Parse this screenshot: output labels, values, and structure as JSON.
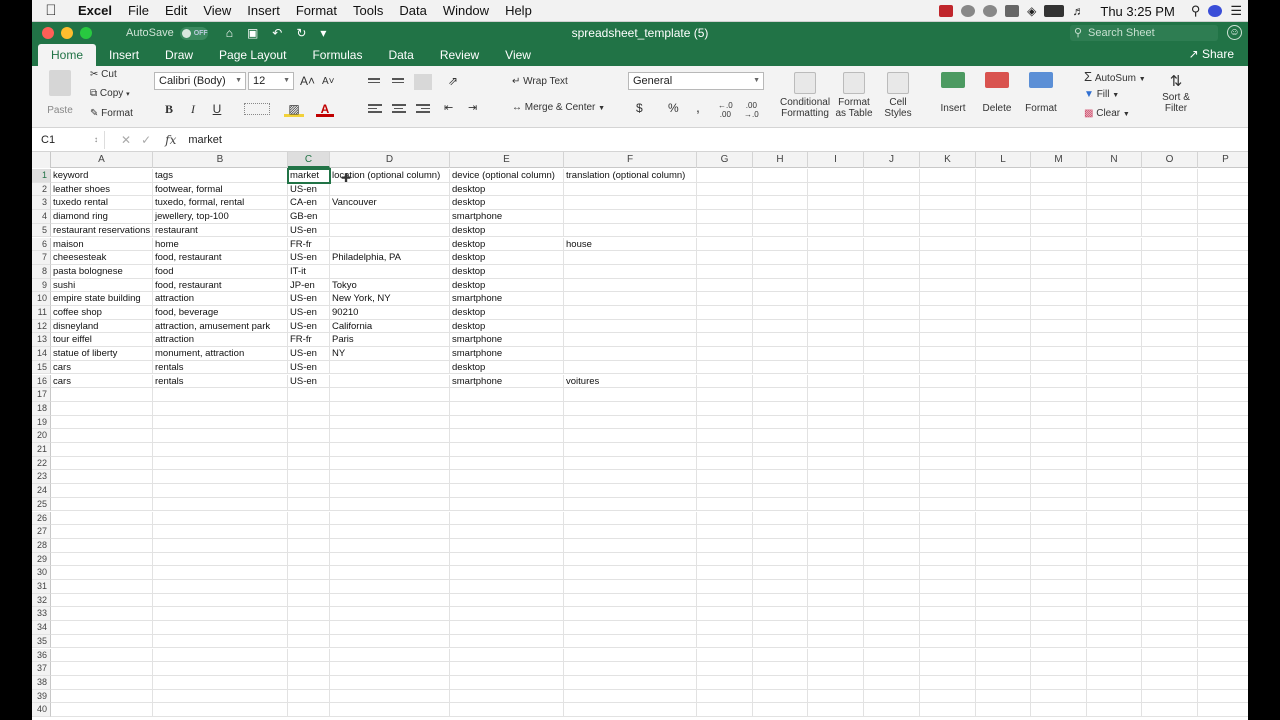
{
  "menubar": {
    "app_name": "Excel",
    "items": [
      "File",
      "Edit",
      "View",
      "Insert",
      "Format",
      "Tools",
      "Data",
      "Window",
      "Help"
    ],
    "clock": "Thu 3:25 PM"
  },
  "titlebar": {
    "autosave_label": "AutoSave",
    "autosave_state": "OFF",
    "document_title": "spreadsheet_template (5)",
    "search_placeholder": "Search Sheet"
  },
  "tabs": [
    "Home",
    "Insert",
    "Draw",
    "Page Layout",
    "Formulas",
    "Data",
    "Review",
    "View"
  ],
  "share_label": "Share",
  "ribbon": {
    "paste": "Paste",
    "cut": "Cut",
    "copy": "Copy",
    "format": "Format",
    "font_name": "Calibri (Body)",
    "font_size": "12",
    "bold": "B",
    "italic": "I",
    "underline": "U",
    "wrap_text": "Wrap Text",
    "merge_center": "Merge & Center",
    "number_format": "General",
    "currency": "$",
    "percent": "%",
    "comma": ",",
    "conditional_formatting": [
      "Conditional",
      "Formatting"
    ],
    "format_as_table": [
      "Format",
      "as Table"
    ],
    "cell_styles": [
      "Cell",
      "Styles"
    ],
    "insert": "Insert",
    "delete": "Delete",
    "format_cells": "Format",
    "autosum": "AutoSum",
    "fill": "Fill",
    "clear": "Clear",
    "sort_filter": [
      "Sort &",
      "Filter"
    ]
  },
  "formula_bar": {
    "cell_ref": "C1",
    "fx": "fx",
    "content": "market"
  },
  "columns": [
    "A",
    "B",
    "C",
    "D",
    "E",
    "F",
    "G",
    "H",
    "I",
    "J",
    "K",
    "L",
    "M",
    "N",
    "O",
    "P"
  ],
  "selected_column": "C",
  "selected_row": 1,
  "rows": [
    {
      "n": "1",
      "cells": [
        "keyword",
        "tags",
        "market",
        "location (optional column)",
        "device (optional column)",
        "translation (optional column)"
      ]
    },
    {
      "n": "2",
      "cells": [
        "leather shoes",
        "footwear, formal",
        "US-en",
        "",
        "desktop",
        ""
      ]
    },
    {
      "n": "3",
      "cells": [
        "tuxedo rental",
        "tuxedo, formal, rental",
        "CA-en",
        "Vancouver",
        "desktop",
        ""
      ]
    },
    {
      "n": "4",
      "cells": [
        "diamond ring",
        "jewellery, top-100",
        "GB-en",
        "",
        "smartphone",
        ""
      ]
    },
    {
      "n": "5",
      "cells": [
        "restaurant reservations",
        "restaurant",
        "US-en",
        "",
        "desktop",
        ""
      ]
    },
    {
      "n": "6",
      "cells": [
        "maison",
        "home",
        "FR-fr",
        "",
        "desktop",
        "house"
      ]
    },
    {
      "n": "7",
      "cells": [
        "cheesesteak",
        "food, restaurant",
        "US-en",
        "Philadelphia, PA",
        "desktop",
        ""
      ]
    },
    {
      "n": "8",
      "cells": [
        "pasta bolognese",
        "food",
        "IT-it",
        "",
        "desktop",
        ""
      ]
    },
    {
      "n": "9",
      "cells": [
        "sushi",
        "food, restaurant",
        "JP-en",
        "Tokyo",
        "desktop",
        ""
      ]
    },
    {
      "n": "10",
      "cells": [
        "empire state building",
        "attraction",
        "US-en",
        "New York, NY",
        "smartphone",
        ""
      ]
    },
    {
      "n": "11",
      "cells": [
        "coffee shop",
        "food, beverage",
        "US-en",
        "90210",
        "desktop",
        ""
      ]
    },
    {
      "n": "12",
      "cells": [
        "disneyland",
        "attraction, amusement park",
        "US-en",
        "California",
        "desktop",
        ""
      ]
    },
    {
      "n": "13",
      "cells": [
        "tour eiffel",
        "attraction",
        "FR-fr",
        "Paris",
        "smartphone",
        ""
      ]
    },
    {
      "n": "14",
      "cells": [
        "statue of liberty",
        "monument, attraction",
        "US-en",
        "NY",
        "smartphone",
        ""
      ]
    },
    {
      "n": "15",
      "cells": [
        "cars",
        "rentals",
        "US-en",
        "",
        "desktop",
        ""
      ]
    },
    {
      "n": "16",
      "cells": [
        "cars",
        "rentals",
        "US-en",
        "",
        "smartphone",
        "voitures"
      ]
    },
    {
      "n": "17",
      "cells": []
    },
    {
      "n": "18",
      "cells": []
    },
    {
      "n": "19",
      "cells": []
    },
    {
      "n": "20",
      "cells": []
    },
    {
      "n": "21",
      "cells": []
    },
    {
      "n": "22",
      "cells": []
    },
    {
      "n": "23",
      "cells": []
    },
    {
      "n": "24",
      "cells": []
    },
    {
      "n": "25",
      "cells": []
    },
    {
      "n": "26",
      "cells": []
    },
    {
      "n": "27",
      "cells": []
    },
    {
      "n": "28",
      "cells": []
    },
    {
      "n": "29",
      "cells": []
    },
    {
      "n": "30",
      "cells": []
    },
    {
      "n": "31",
      "cells": []
    },
    {
      "n": "32",
      "cells": []
    },
    {
      "n": "33",
      "cells": []
    },
    {
      "n": "34",
      "cells": []
    },
    {
      "n": "35",
      "cells": []
    },
    {
      "n": "36",
      "cells": []
    },
    {
      "n": "37",
      "cells": []
    },
    {
      "n": "38",
      "cells": []
    },
    {
      "n": "39",
      "cells": []
    },
    {
      "n": "40",
      "cells": []
    }
  ],
  "colors": {
    "excel_green": "#217346",
    "ribbon_bg": "#f3f3f3"
  }
}
